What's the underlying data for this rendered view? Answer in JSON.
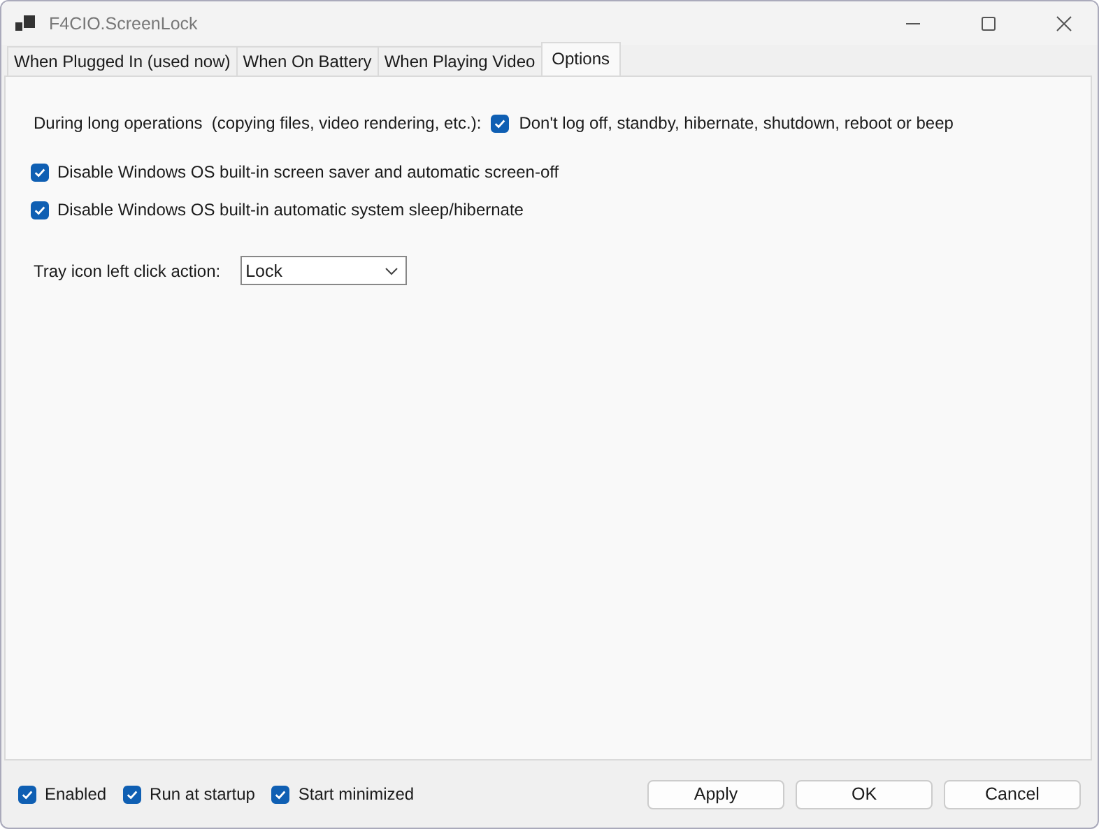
{
  "window": {
    "title": "F4CIO.ScreenLock"
  },
  "tabs": [
    {
      "label": "When Plugged In (used now)",
      "selected": false
    },
    {
      "label": "When On Battery",
      "selected": false
    },
    {
      "label": "When Playing Video",
      "selected": false
    },
    {
      "label": "Options",
      "selected": true
    }
  ],
  "long_operations": {
    "label": "During long operations  (copying files, video rendering, etc.):",
    "option": {
      "label": "Don't log off, standby, hibernate, shutdown, reboot or beep",
      "checked": true
    }
  },
  "options": [
    {
      "label": "Disable Windows OS built-in screen saver and automatic screen-off",
      "checked": true
    },
    {
      "label": "Disable Windows OS built-in automatic system sleep/hibernate",
      "checked": true
    }
  ],
  "tray_action": {
    "label": "Tray icon left click action:",
    "value": "Lock"
  },
  "footer_options": [
    {
      "label": "Enabled",
      "checked": true
    },
    {
      "label": "Run at startup",
      "checked": true
    },
    {
      "label": "Start minimized",
      "checked": true
    }
  ],
  "buttons": [
    "Apply",
    "OK",
    "Cancel"
  ]
}
